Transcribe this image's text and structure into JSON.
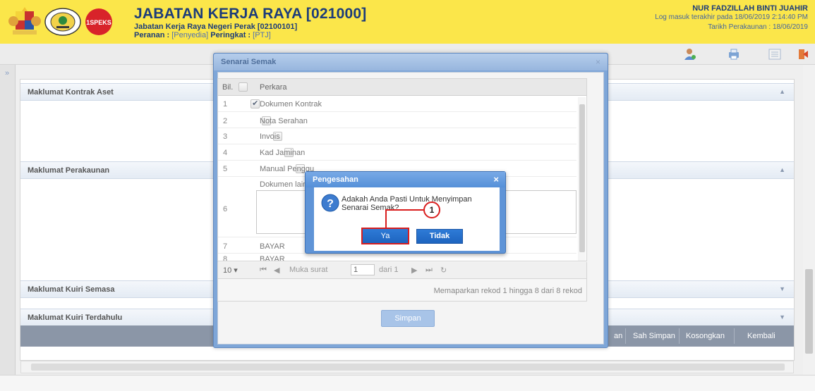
{
  "header": {
    "title": "JABATAN KERJA RAYA [021000]",
    "subtitle": "Jabatan Kerja Raya Negeri Perak [02100101]",
    "role_prefix": "Peranan : ",
    "role_value": "[Penyedia]",
    "level_prefix": " Peringkat : ",
    "level_value": "[PTJ]",
    "spk_logo_text": "1SPEKS",
    "user_name": "NUR FADZILLAH BINTI JUAHIR",
    "last_login": "Log masuk terakhir pada 18/06/2019 2:14:40 PM",
    "account_date": "Tarikh Perakaunan : 18/06/2019"
  },
  "toolbar": {
    "icons": [
      "user-icon",
      "print-icon",
      "list-icon",
      "logout-icon"
    ]
  },
  "sections": [
    {
      "title": "Maklumat Kontrak Aset"
    },
    {
      "title": "Maklumat Perakaunan"
    },
    {
      "title": "Maklumat Kuiri Semasa"
    },
    {
      "title": "Maklumat Kuiri Terdahulu"
    }
  ],
  "actions": {
    "partial": "an",
    "sah_simpan": "Sah Simpan",
    "kosongkan": "Kosongkan",
    "kembali": "Kembali"
  },
  "senarai": {
    "title": "Senarai Semak",
    "col_bil": "Bil.",
    "col_perkara": "Perkara",
    "rows": [
      {
        "no": "1",
        "text": "Dokumen Kontrak",
        "checked": true
      },
      {
        "no": "2",
        "text": "Nota Serahan",
        "checked": false
      },
      {
        "no": "3",
        "text": "Invois",
        "checked": false
      },
      {
        "no": "4",
        "text": "Kad Jaminan",
        "checked": false
      },
      {
        "no": "5",
        "text": "Manual Penggu",
        "checked": false
      },
      {
        "no": "6",
        "text": "Dokumen lain y",
        "checked": false
      },
      {
        "no": "7",
        "text": "BAYAR",
        "checked": false
      },
      {
        "no": "8",
        "text": "BAYAR",
        "checked": false
      }
    ],
    "pager": {
      "page_size": "10",
      "muka_surat": "Muka surat",
      "page": "1",
      "dari": "dari 1"
    },
    "summary": "Memaparkan rekod 1 hingga 8 dari 8 rekod",
    "simpan": "Simpan"
  },
  "confirm": {
    "title": "Pengesahan",
    "message": "Adakah Anda Pasti Untuk Menyimpan Senarai Semak?",
    "ya": "Ya",
    "tidak": "Tidak"
  },
  "callout": {
    "number": "1"
  },
  "colors": {
    "header_bg": "#fbe64a",
    "dialog_blue": "#5f94d7",
    "button_blue": "#1e64bf",
    "highlight_red": "#d91e1e"
  }
}
